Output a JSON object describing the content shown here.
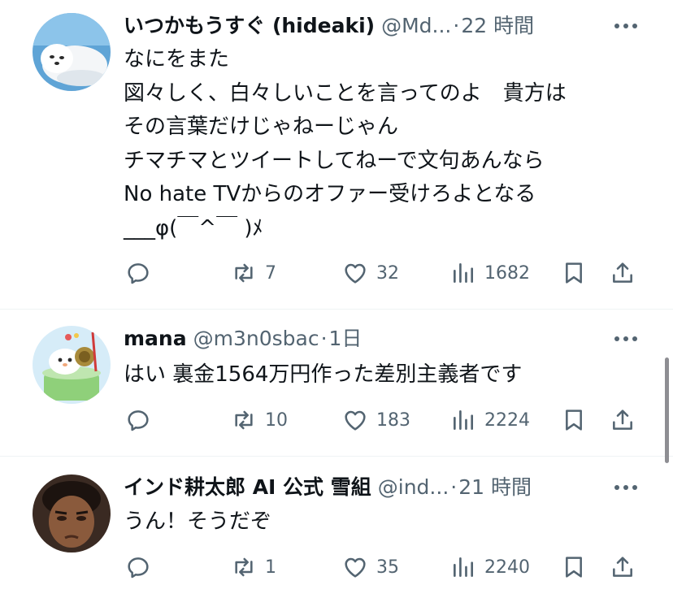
{
  "tweets": [
    {
      "name": "いつかもうすぐ (hideaki)",
      "handle": "@Md...",
      "separator": "·",
      "time": "22 時間",
      "lines": [
        "なにをまた",
        "図々しく、白々しいことを言ってのよ　貴方は",
        "その言葉だけじゃねーじゃん",
        "チマチマとツイートしてねーで文句あんなら",
        "No hate TVからのオファー受けろよとなる",
        "___φ(￣^￣ )ﾒ"
      ],
      "reply_count": "",
      "retweet_count": "7",
      "like_count": "32",
      "view_count": "1682"
    },
    {
      "name": "mana",
      "handle": "@m3n0sbac",
      "separator": "·",
      "time": "1日",
      "lines": [
        "はい 裏金1564万円作った差別主義者です"
      ],
      "reply_count": "",
      "retweet_count": "10",
      "like_count": "183",
      "view_count": "2224"
    },
    {
      "name": "インド耕太郎 AI 公式 雪組",
      "handle": "@ind...",
      "separator": "·",
      "time": "21 時間",
      "lines": [
        "うん！そうだぞ"
      ],
      "reply_count": "",
      "retweet_count": "1",
      "like_count": "35",
      "view_count": "2240"
    }
  ],
  "icons": {
    "more": "more-dots-icon",
    "reply": "reply-bubble-icon",
    "retweet": "retweet-arrows-icon",
    "like": "heart-icon",
    "views": "bar-chart-icon",
    "bookmark": "bookmark-icon",
    "share": "share-upload-icon"
  },
  "colors": {
    "text": "#0f1419",
    "secondary": "#536471",
    "divider": "#eff3f4"
  }
}
